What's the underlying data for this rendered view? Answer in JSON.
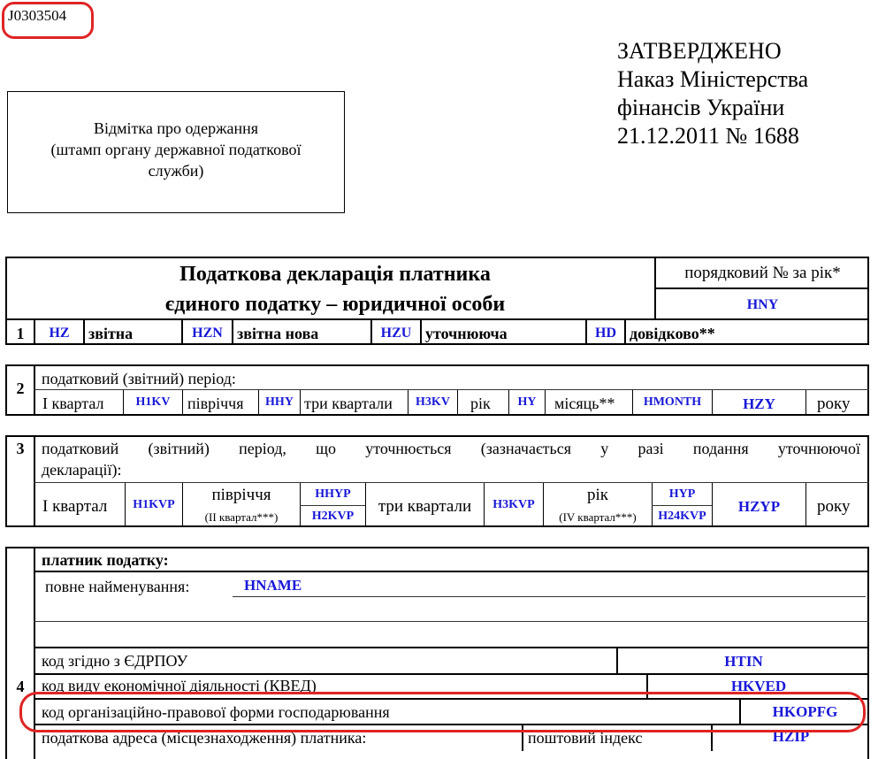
{
  "form_code": "J0303504",
  "approval": {
    "line1": "ЗАТВЕРДЖЕНО",
    "line2": "Наказ Міністерства",
    "line3": "фінансів України",
    "line4": "21.12.2011 № 1688"
  },
  "stamp": {
    "line1": "Відмітка про одержання",
    "line2": "(штамп органу державної податкової",
    "line3": "служби)"
  },
  "title": {
    "line1": "Податкова декларація платника",
    "line2": "єдиного податку – юридичної особи",
    "seq_label": "порядковий № за рік*",
    "seq_code": "HNY"
  },
  "row1": {
    "num": "1",
    "items": [
      {
        "code": "HZ",
        "label": "звітна"
      },
      {
        "code": "HZN",
        "label": "звітна нова"
      },
      {
        "code": "HZU",
        "label": "уточнююча"
      },
      {
        "code": "HD",
        "label": "довідково**"
      }
    ]
  },
  "row2": {
    "num": "2",
    "heading": "податковий (звітний) період:",
    "q1": "І квартал",
    "q1_code": "H1KV",
    "half": "півріччя",
    "half_code": "HHY",
    "q3": "три квартали",
    "q3_code": "H3KV",
    "year": "рік",
    "year_code": "HY",
    "month": "місяць**",
    "month_code": "HMONTH",
    "year_code2": "HZY",
    "year_word": "року"
  },
  "row3": {
    "num": "3",
    "heading_line1": "податковий (звітний) період, що уточнюється (зазначається у разі подання уточнюючої",
    "heading_line2": "декларації):",
    "q1": "І квартал",
    "q1_code": "H1KVP",
    "half": "півріччя",
    "half_sub": "(II квартал***)",
    "half_code_top": "HHYP",
    "half_code_bottom": "H2KVP",
    "q3": "три квартали",
    "q3_code": "H3KVP",
    "year": "рік",
    "year_sub": "(IV квартал***)",
    "year_code_top": "HYP",
    "year_code_bottom": "H24KVP",
    "year_code2": "HZYP",
    "year_word": "року"
  },
  "row4": {
    "num": "4",
    "heading": "платник податку:",
    "full_name_label": "повне найменування:",
    "full_name_code": "HNAME",
    "edrpou_label": "код згідно з ЄДРПОУ",
    "edrpou_code": "HTIN",
    "kved_label": "код виду економічної діяльності (КВЕД)",
    "kved_code": "HKVED",
    "kopfg_label": "код організаційно-правової форми господарювання",
    "kopfg_code": "HKOPFG",
    "address_label": "податкова адреса (місцезнаходження) платника:",
    "postal_label": "поштовий індекс",
    "postal_code": "HZIP"
  },
  "colors": {
    "code_blue": "#1818d8",
    "highlight_red": "#e02424"
  }
}
